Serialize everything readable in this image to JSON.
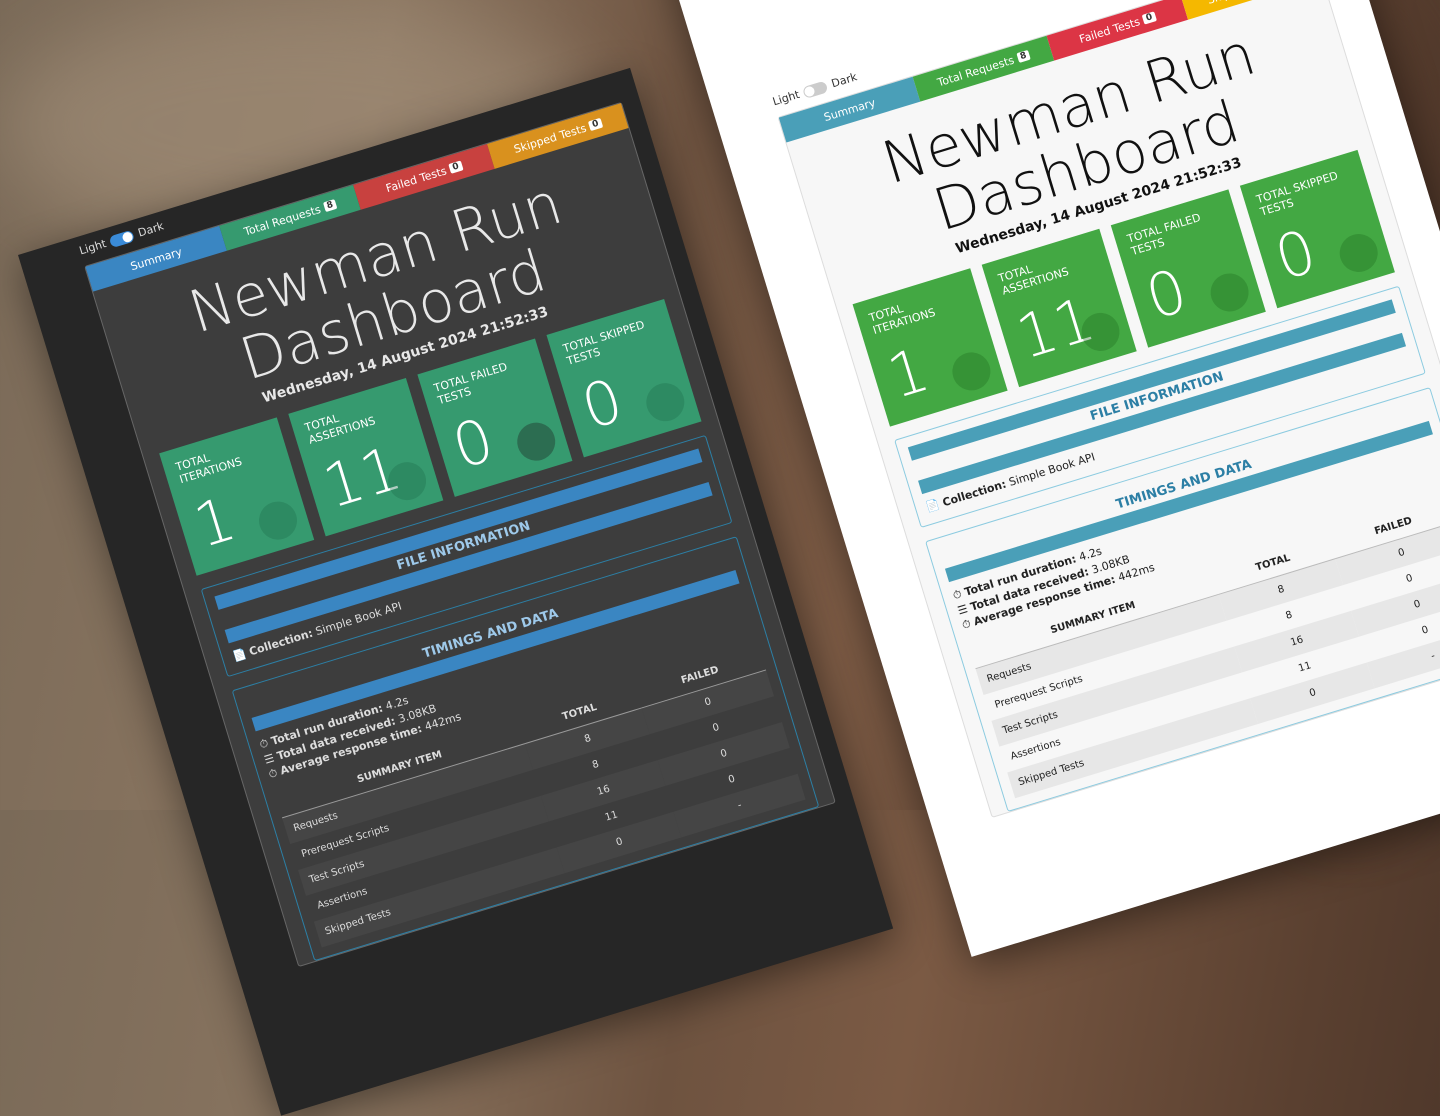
{
  "toggle": {
    "light": "Light",
    "dark": "Dark"
  },
  "tabs": {
    "summary": "Summary",
    "total_requests": "Total Requests",
    "total_requests_count": "8",
    "failed_tests": "Failed Tests",
    "failed_tests_count": "0",
    "skipped_tests": "Skipped Tests",
    "skipped_tests_count": "0"
  },
  "title_line1": "Newman Run",
  "title_line2": "Dashboard",
  "date": "Wednesday, 14 August 2024 21:52:33",
  "stats": {
    "iterations_label": "Total Iterations",
    "iterations": "1",
    "assertions_label": "Total Assertions",
    "assertions": "11",
    "failed_label": "Total Failed Tests",
    "failed": "0",
    "skipped_label": "Total Skipped Tests",
    "skipped": "0"
  },
  "file_info": {
    "heading": "FILE INFORMATION",
    "collection_label": "Collection:",
    "collection": "Simple Book API"
  },
  "timings": {
    "heading": "TIMINGS AND DATA",
    "duration_label": "Total run duration:",
    "duration": "4.2s",
    "data_label": "Total data received:",
    "data": "3.08KB",
    "response_label": "Average response time:",
    "response": "442ms"
  },
  "table": {
    "headers": [
      "SUMMARY ITEM",
      "TOTAL",
      "FAILED"
    ],
    "rows": [
      [
        "Requests",
        "8",
        "0"
      ],
      [
        "Prerequest Scripts",
        "8",
        "0"
      ],
      [
        "Test Scripts",
        "16",
        "0"
      ],
      [
        "Assertions",
        "11",
        "0"
      ],
      [
        "Skipped Tests",
        "0",
        "-"
      ]
    ]
  },
  "colors": {
    "dark_bg": "#262626",
    "dark_card": "#369a6f",
    "light_card": "#43a843",
    "summary_tab": "#3a86c2",
    "failed_tab": "#dc3545",
    "skipped_tab": "#f5b800"
  }
}
